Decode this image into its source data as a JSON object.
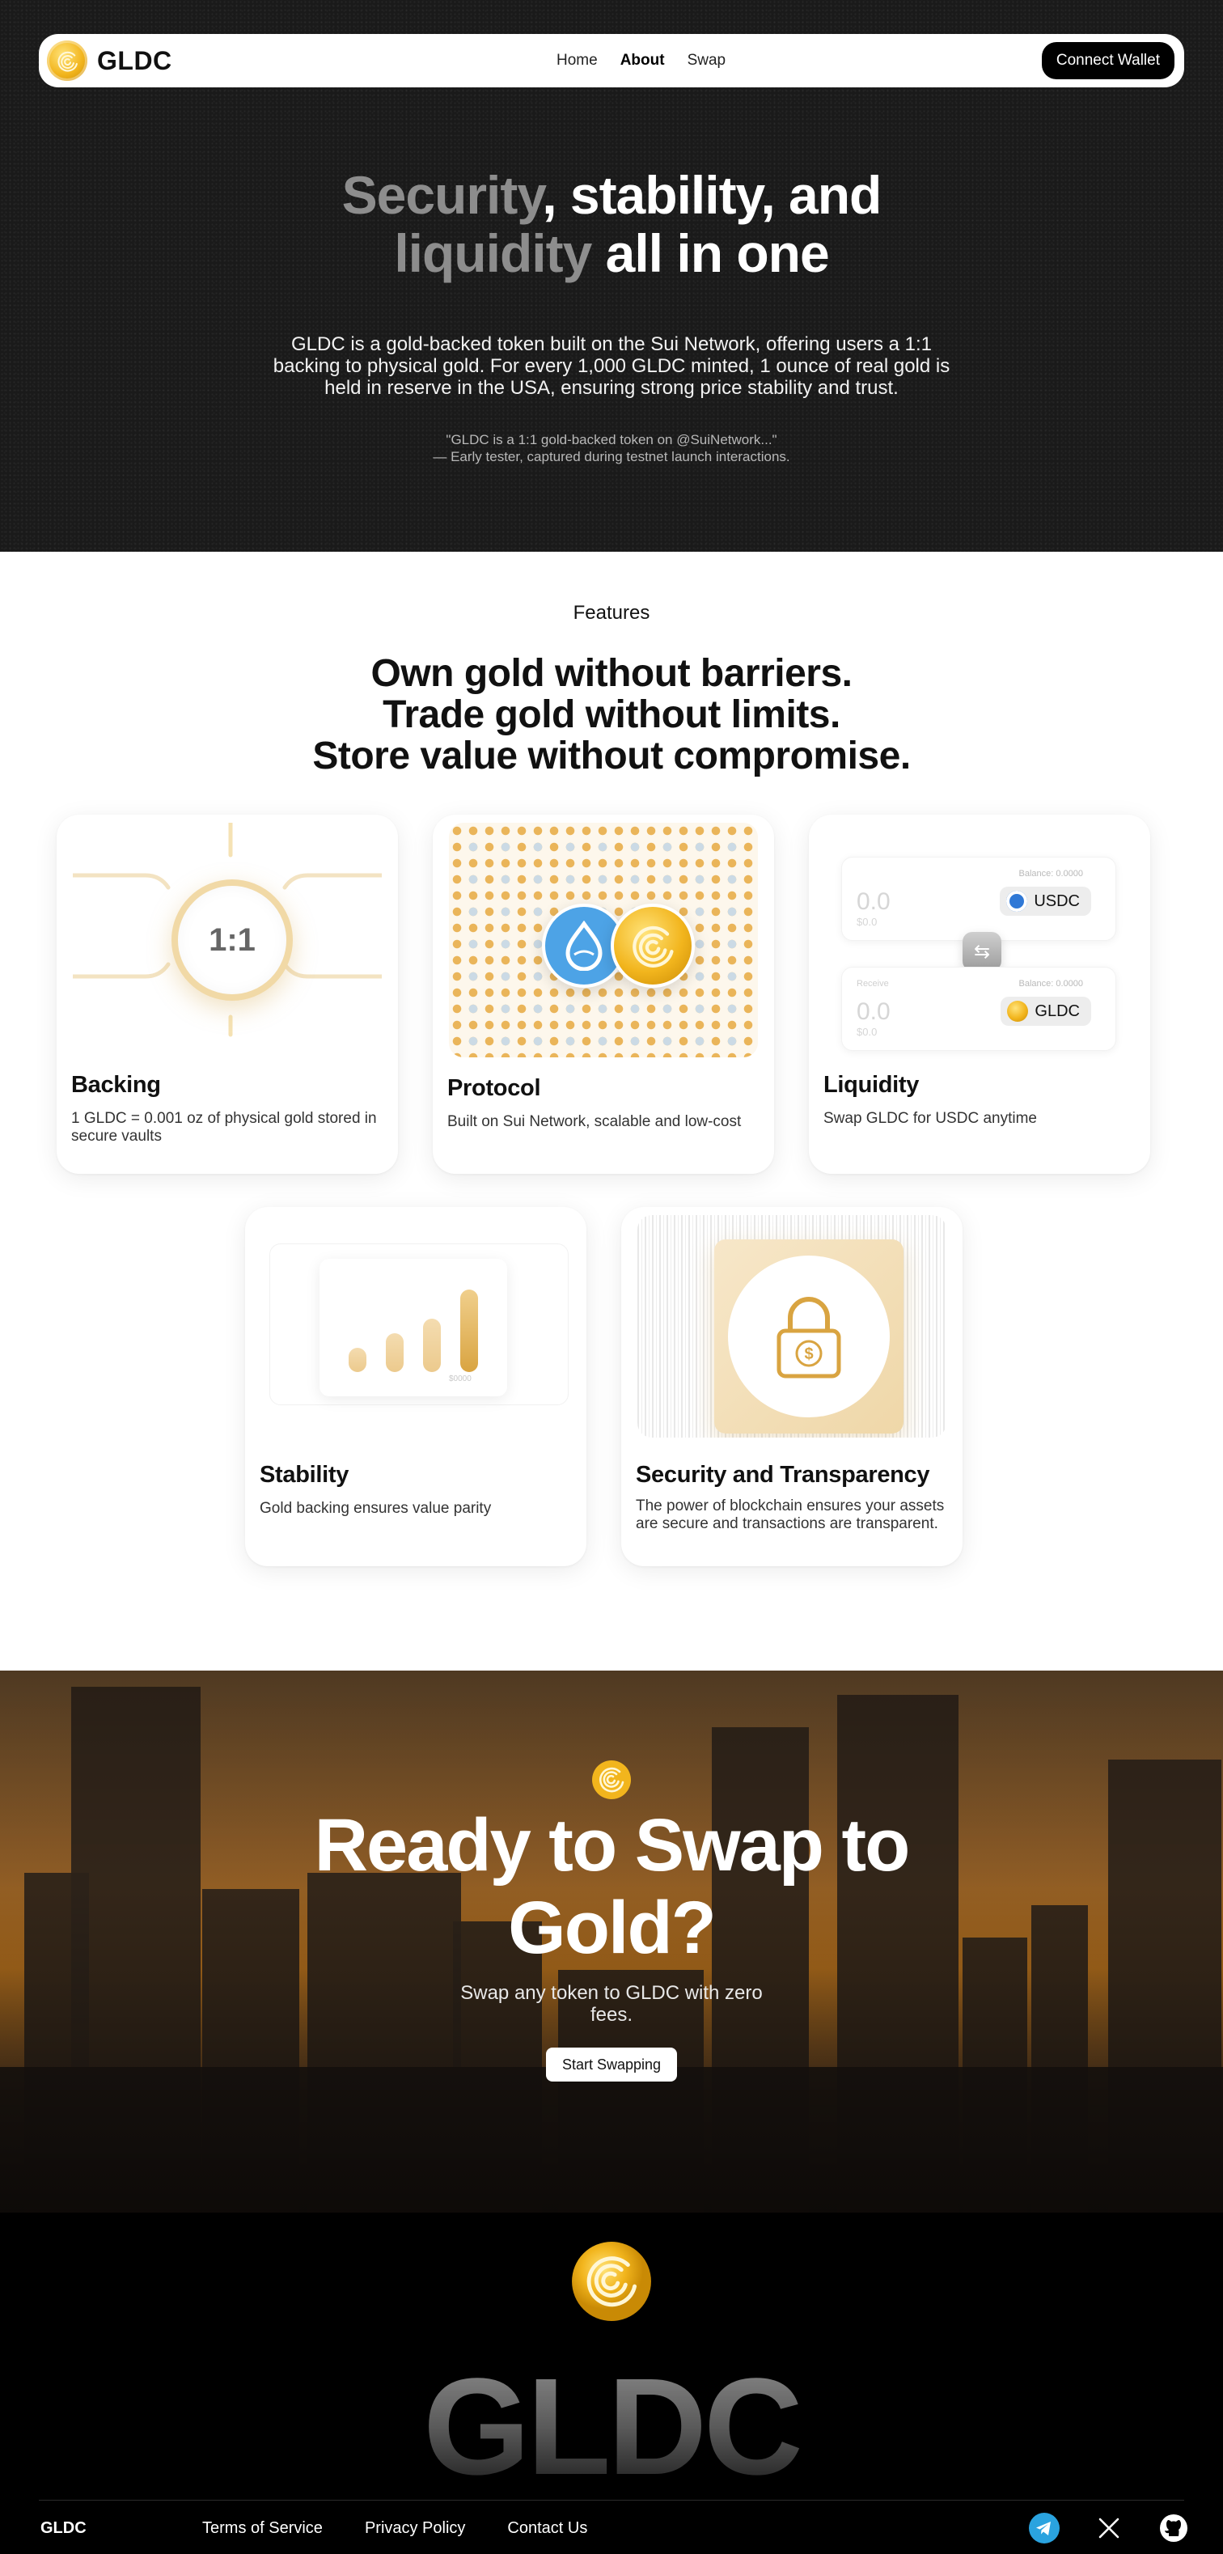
{
  "nav": {
    "brand": "GLDC",
    "links": [
      {
        "label": "Home",
        "active": false
      },
      {
        "label": "About",
        "active": true
      },
      {
        "label": "Swap",
        "active": false
      }
    ],
    "connect_label": "Connect Wallet"
  },
  "hero": {
    "title_line1_muted": "Security",
    "title_line1_rest": ", stability, and",
    "title_line2_muted": "liquidity",
    "title_line2_rest": " all in one",
    "description": "GLDC is a gold-backed token built on the Sui Network, offering users a 1:1 backing to physical gold. For every 1,000 GLDC minted, 1 ounce of real gold is held in reserve in the USA, ensuring strong price stability and trust.",
    "quote": "\"GLDC is a 1:1 gold-backed token on @SuiNetwork...\"",
    "quote_attribution": "— Early tester, captured during testnet launch interactions."
  },
  "features": {
    "eyebrow": "Features",
    "headline": [
      "Own gold without barriers.",
      "Trade gold without limits.",
      "Store value without compromise."
    ],
    "cards": [
      {
        "title": "Backing",
        "description": "1 GLDC = 0.001 oz of physical gold stored in secure vaults",
        "visual_text": "1:1"
      },
      {
        "title": "Protocol",
        "description": "Built on Sui Network, scalable and low-cost"
      },
      {
        "title": "Liquidity",
        "description": "Swap GLDC for USDC anytime"
      },
      {
        "title": "Stability",
        "description": "Gold backing ensures value parity"
      },
      {
        "title": "Security and Transparency",
        "description": "The power of blockchain ensures your assets are secure and transactions are transparent."
      }
    ],
    "swap_widget": {
      "top": {
        "amount": "0.0",
        "sub": "$0.0",
        "balance": "Balance: 0.0000",
        "token": "USDC"
      },
      "bottom": {
        "label": "Receive",
        "amount": "0.0",
        "sub": "$0.0",
        "balance": "Balance: 0.0000",
        "token": "GLDC"
      }
    },
    "stability_chart": {
      "type": "bar",
      "values": [
        0.25,
        0.4,
        0.55,
        0.85
      ],
      "label": "$0000"
    }
  },
  "cta": {
    "title": "Ready to Swap to Gold?",
    "subtitle": "Swap any token to GLDC with zero fees.",
    "button": "Start Swapping"
  },
  "footer": {
    "wordmark": "GLDC",
    "brand": "GLDC",
    "links": [
      "Terms of Service",
      "Privacy Policy",
      "Contact Us"
    ],
    "social": [
      "telegram-icon",
      "x-icon",
      "github-icon"
    ]
  },
  "colors": {
    "gold": "#f2b51d",
    "gold_light": "#f1d9a6",
    "sui_blue": "#4da3e6",
    "hero_bg": "#1a1a1a",
    "footer_bg": "#000000"
  }
}
